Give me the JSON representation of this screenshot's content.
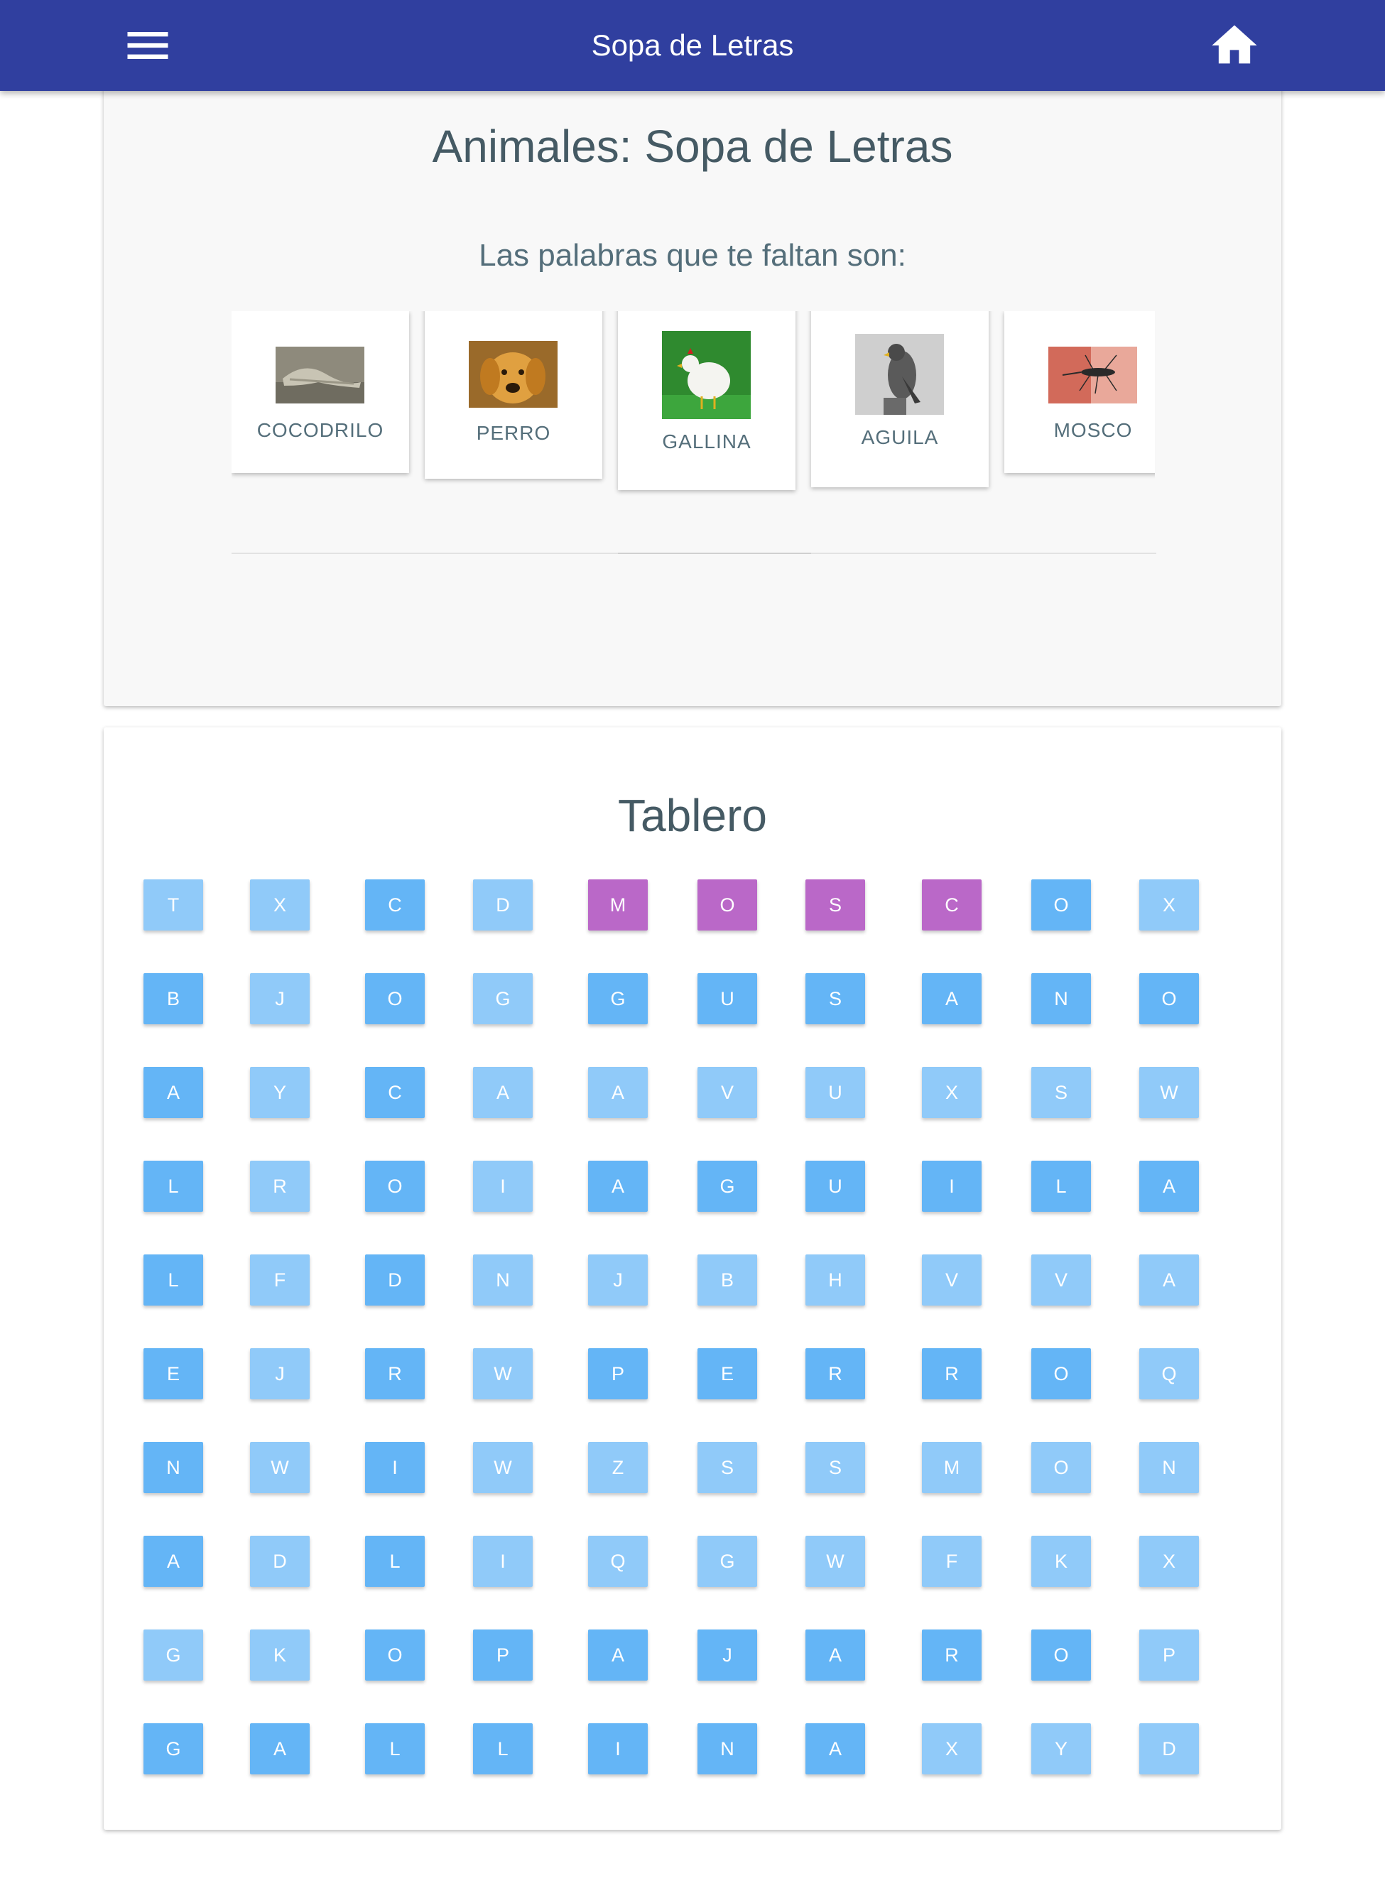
{
  "appbar": {
    "title": "Sopa de Letras",
    "menu_icon": "menu-icon",
    "home_icon": "home-icon",
    "color": "#303f9f"
  },
  "header_card": {
    "title": "Animales: Sopa de Letras",
    "subtitle": "Las palabras que te faltan son:"
  },
  "words": [
    {
      "label": "COCODRILO",
      "image": "crocodile-photo"
    },
    {
      "label": "PERRO",
      "image": "dog-photo"
    },
    {
      "label": "GALLINA",
      "image": "hen-photo"
    },
    {
      "label": "AGUILA",
      "image": "falcon-photo"
    },
    {
      "label": "MOSCO",
      "image": "mosquito-photo"
    }
  ],
  "board": {
    "title": "Tablero",
    "rows": [
      [
        "T",
        "X",
        "C",
        "D",
        "M",
        "O",
        "S",
        "C",
        "O",
        "X"
      ],
      [
        "B",
        "J",
        "O",
        "G",
        "G",
        "U",
        "S",
        "A",
        "N",
        "O"
      ],
      [
        "A",
        "Y",
        "C",
        "A",
        "A",
        "V",
        "U",
        "X",
        "S",
        "W"
      ],
      [
        "L",
        "R",
        "O",
        "I",
        "A",
        "G",
        "U",
        "I",
        "L",
        "A"
      ],
      [
        "L",
        "F",
        "D",
        "N",
        "J",
        "B",
        "H",
        "V",
        "V",
        "A"
      ],
      [
        "E",
        "J",
        "R",
        "W",
        "P",
        "E",
        "R",
        "R",
        "O",
        "Q"
      ],
      [
        "N",
        "W",
        "I",
        "W",
        "Z",
        "S",
        "S",
        "M",
        "O",
        "N"
      ],
      [
        "A",
        "D",
        "L",
        "I",
        "Q",
        "G",
        "W",
        "F",
        "K",
        "X"
      ],
      [
        "G",
        "K",
        "O",
        "P",
        "A",
        "J",
        "A",
        "R",
        "O",
        "P"
      ],
      [
        "G",
        "A",
        "L",
        "L",
        "I",
        "N",
        "A",
        "X",
        "Y",
        "D"
      ]
    ],
    "found_word": "MOSC",
    "colors": {
      "light": "#90caf9",
      "mid": "#64b5f6",
      "dark": "#42a5f5",
      "found": "#ba68c8"
    }
  }
}
